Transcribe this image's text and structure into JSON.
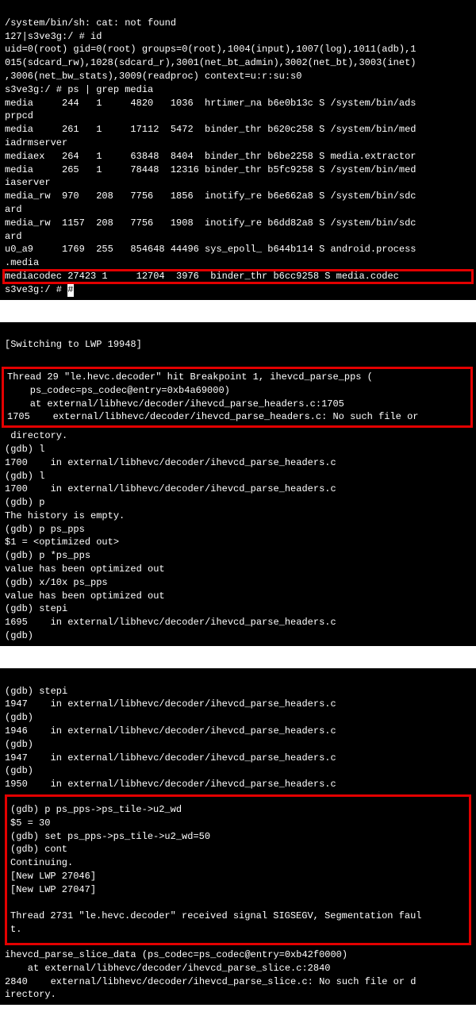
{
  "block1": {
    "lines": [
      "/system/bin/sh: cat: not found",
      "127|s3ve3g:/ # id",
      "uid=0(root) gid=0(root) groups=0(root),1004(input),1007(log),1011(adb),1",
      "015(sdcard_rw),1028(sdcard_r),3001(net_bt_admin),3002(net_bt),3003(inet)",
      ",3006(net_bw_stats),3009(readproc) context=u:r:su:s0",
      "s3ve3g:/ # ps | grep media",
      "media     244   1     4820   1036  hrtimer_na b6e0b13c S /system/bin/ads",
      "prpcd",
      "media     261   1     17112  5472  binder_thr b620c258 S /system/bin/med",
      "iadrmserver",
      "mediaex   264   1     63848  8404  binder_thr b6be2258 S media.extractor",
      "media     265   1     78448  12316 binder_thr b5fc9258 S /system/bin/med",
      "iaserver",
      "media_rw  970   208   7756   1856  inotify_re b6e662a8 S /system/bin/sdc",
      "ard",
      "media_rw  1157  208   7756   1908  inotify_re b6dd82a8 S /system/bin/sdc",
      "ard",
      "u0_a9     1769  255   854648 44496 sys_epoll_ b644b114 S android.process",
      ".media"
    ],
    "highlighted": "mediacodec 27423 1     12704  3976  binder_thr b6cc9258 S media.codec",
    "prompt": "s3ve3g:/ # "
  },
  "block2": {
    "pre": [
      "[Switching to LWP 19948]",
      ""
    ],
    "highlighted": [
      "Thread 29 \"le.hevc.decoder\" hit Breakpoint 1, ihevcd_parse_pps (",
      "    ps_codec=ps_codec@entry=0xb4a69000)",
      "    at external/libhevc/decoder/ihevcd_parse_headers.c:1705",
      "1705    external/libhevc/decoder/ihevcd_parse_headers.c: No such file or"
    ],
    "post": [
      " directory.",
      "(gdb) l",
      "1700    in external/libhevc/decoder/ihevcd_parse_headers.c",
      "(gdb) l",
      "1700    in external/libhevc/decoder/ihevcd_parse_headers.c",
      "(gdb) p",
      "The history is empty.",
      "(gdb) p ps_pps",
      "$1 = <optimized out>",
      "(gdb) p *ps_pps",
      "value has been optimized out",
      "(gdb) x/10x ps_pps",
      "value has been optimized out",
      "(gdb) stepi",
      "1695    in external/libhevc/decoder/ihevcd_parse_headers.c",
      "(gdb)"
    ]
  },
  "block3": {
    "pre": [
      "(gdb) stepi",
      "1947    in external/libhevc/decoder/ihevcd_parse_headers.c",
      "(gdb)",
      "1946    in external/libhevc/decoder/ihevcd_parse_headers.c",
      "(gdb)",
      "1947    in external/libhevc/decoder/ihevcd_parse_headers.c",
      "(gdb)",
      "1950    in external/libhevc/decoder/ihevcd_parse_headers.c"
    ],
    "highlighted": [
      "(gdb) p ps_pps->ps_tile->u2_wd",
      "$5 = 30",
      "(gdb) set ps_pps->ps_tile->u2_wd=50",
      "(gdb) cont",
      "Continuing.",
      "[New LWP 27046]",
      "[New LWP 27047]",
      "",
      "Thread 2731 \"le.hevc.decoder\" received signal SIGSEGV, Segmentation faul",
      "t."
    ],
    "post": [
      "ihevcd_parse_slice_data (ps_codec=ps_codec@entry=0xb42f0000)",
      "    at external/libhevc/decoder/ihevcd_parse_slice.c:2840",
      "2840    external/libhevc/decoder/ihevcd_parse_slice.c: No such file or d",
      "irectory."
    ]
  }
}
